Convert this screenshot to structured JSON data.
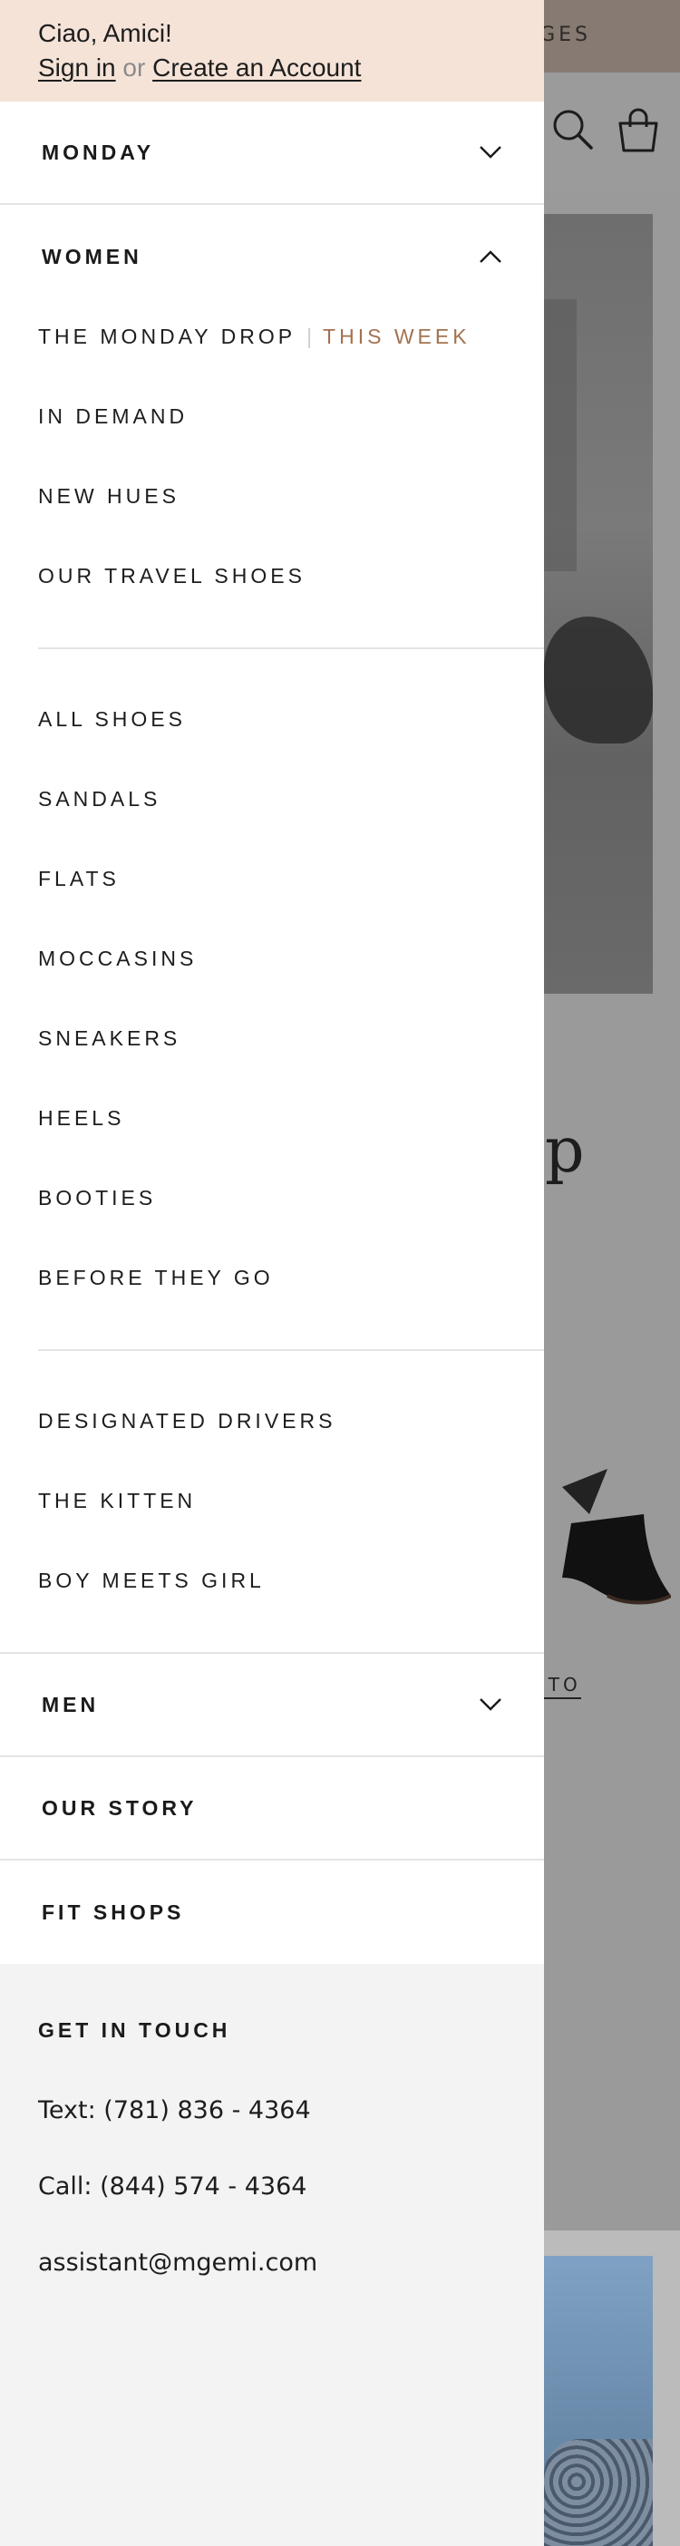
{
  "background": {
    "promo_text": "GES",
    "hero_title_fragment": "op",
    "link_fragment": "OTO"
  },
  "greeting": {
    "hello": "Ciao, Amici!",
    "sign_in": "Sign in",
    "or": "or",
    "create_account": "Create an Account"
  },
  "sections": {
    "monday": "MONDAY",
    "women": "WOMEN",
    "men": "MEN",
    "our_story": "OUR STORY",
    "fit_shops": "FIT SHOPS"
  },
  "women_menu": {
    "monday_drop": "THE MONDAY DROP",
    "separator": "|",
    "this_week": "THIS WEEK",
    "group1": [
      "IN DEMAND",
      "NEW HUES",
      "OUR TRAVEL SHOES"
    ],
    "group2": [
      "ALL SHOES",
      "SANDALS",
      "FLATS",
      "MOCCASINS",
      "SNEAKERS",
      "HEELS",
      "BOOTIES",
      "BEFORE THEY GO"
    ],
    "group3": [
      "DESIGNATED DRIVERS",
      "THE KITTEN",
      "BOY MEETS GIRL"
    ]
  },
  "contact": {
    "title": "GET IN TOUCH",
    "text": "Text: (781) 836 - 4364",
    "call": "Call: (844) 574 - 4364",
    "email": "assistant@mgemi.com"
  },
  "colors": {
    "greeting_bg": "#f5e3d8",
    "highlight": "#a2724f",
    "contact_bg": "#f3f3f3"
  }
}
